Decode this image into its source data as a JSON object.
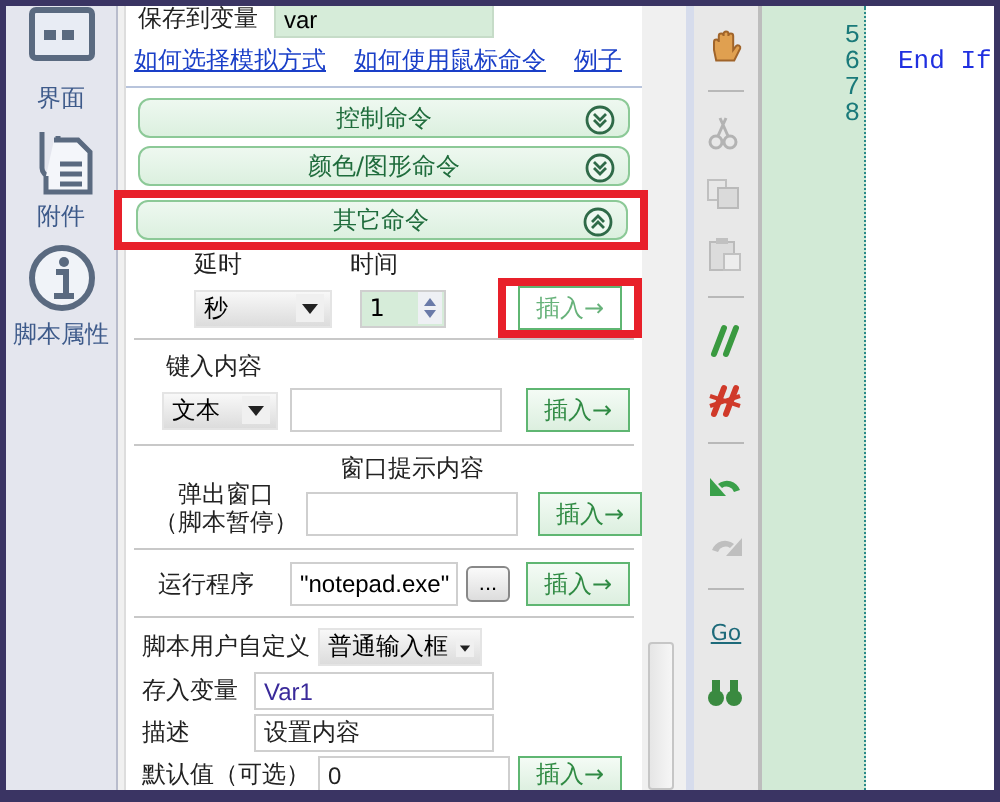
{
  "sidebar": {
    "items": [
      {
        "label": "界面",
        "kind": "layout"
      },
      {
        "label": "附件",
        "kind": "attachment"
      },
      {
        "label": "脚本属性",
        "kind": "info"
      }
    ]
  },
  "save_to_variable": {
    "label": "保存到变量",
    "value": "var"
  },
  "help_links": [
    "如何选择模拟方式",
    "如何使用鼠标命令",
    "例子"
  ],
  "sections": [
    {
      "title": "控制命令",
      "expanded": false,
      "highlighted": false
    },
    {
      "title": "颜色/图形命令",
      "expanded": false,
      "highlighted": false
    },
    {
      "title": "其它命令",
      "expanded": true,
      "highlighted": true
    }
  ],
  "delay": {
    "unit_label": "延时",
    "unit": "秒",
    "time_label": "时间",
    "time": "1",
    "insert": "插入→",
    "highlighted": true
  },
  "type_text": {
    "label": "键入内容",
    "mode": "文本",
    "insert": "插入→"
  },
  "popup": {
    "label_lines": [
      "弹出窗口",
      "（脚本暂停）"
    ],
    "content_label": "窗口提示内容",
    "insert": "插入→"
  },
  "run_program": {
    "label": "运行程序",
    "value": "\"notepad.exe\"",
    "browse": "...",
    "insert": "插入→"
  },
  "custom_input": {
    "label": "脚本用户自定义",
    "type": "普通输入框",
    "fields": [
      {
        "label": "存入变量",
        "value": "Var1"
      },
      {
        "label": "描述",
        "value": "设置内容"
      },
      {
        "label": "默认值（可选）",
        "value": "0"
      }
    ],
    "insert": "插入→"
  },
  "toolbar": [
    {
      "kind": "hand",
      "disabled": false
    },
    {
      "kind": "separator"
    },
    {
      "kind": "scissors",
      "disabled": true
    },
    {
      "kind": "copy",
      "disabled": true
    },
    {
      "kind": "paste",
      "disabled": true
    },
    {
      "kind": "separator"
    },
    {
      "kind": "comment",
      "disabled": false
    },
    {
      "kind": "uncomment",
      "disabled": false
    },
    {
      "kind": "separator"
    },
    {
      "kind": "undo",
      "disabled": false
    },
    {
      "kind": "redo",
      "disabled": true
    },
    {
      "kind": "separator"
    },
    {
      "kind": "goto",
      "text": "Go",
      "disabled": false
    },
    {
      "kind": "find",
      "disabled": false
    }
  ],
  "code": {
    "lines": [
      {
        "number": "5"
      },
      {
        "number": "6",
        "text": "End If"
      },
      {
        "number": "7"
      },
      {
        "number": "8"
      }
    ]
  }
}
